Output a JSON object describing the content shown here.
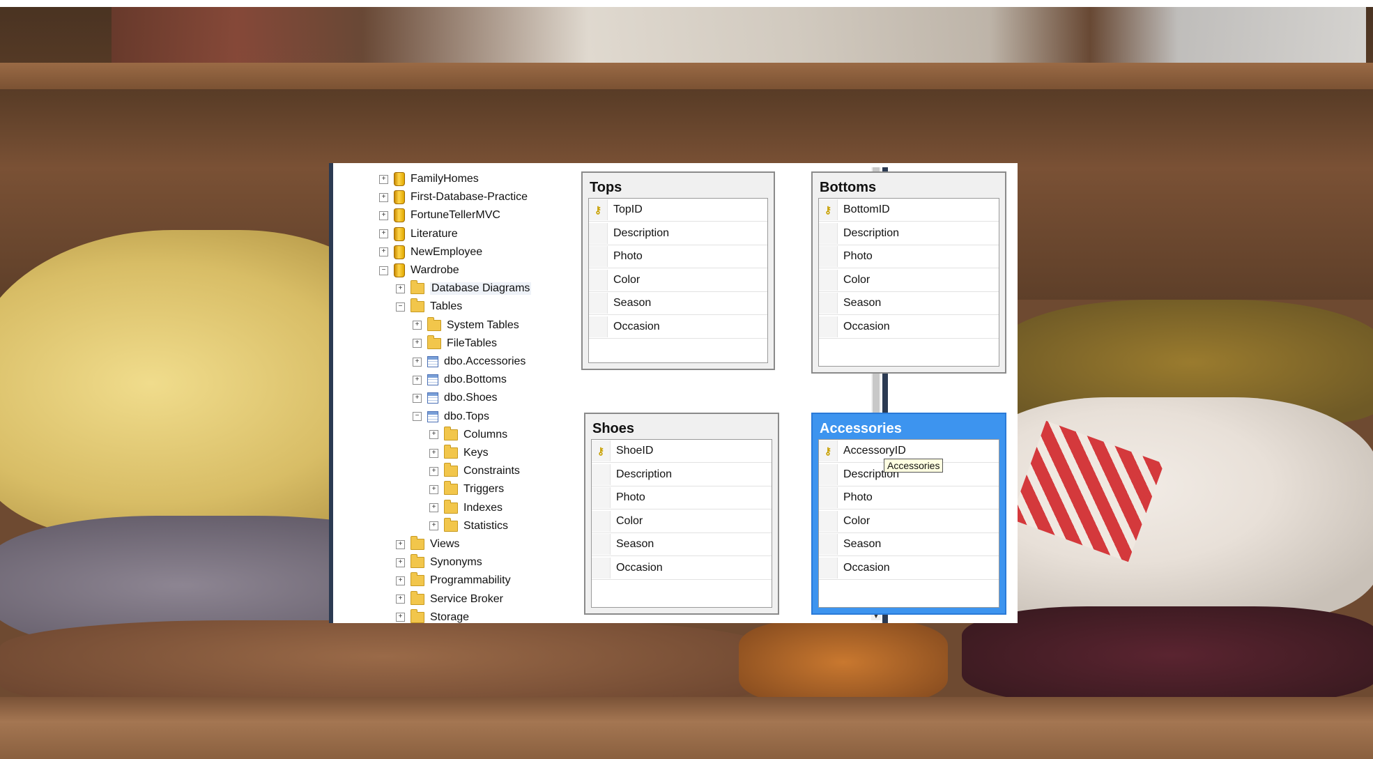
{
  "explorer": {
    "items": [
      {
        "label": "FamilyHomes",
        "icon": "database-icon",
        "expander": "+",
        "level": 0
      },
      {
        "label": "First-Database-Practice",
        "icon": "database-icon",
        "expander": "+",
        "level": 0
      },
      {
        "label": "FortuneTellerMVC",
        "icon": "database-icon",
        "expander": "+",
        "level": 0
      },
      {
        "label": "Literature",
        "icon": "database-icon",
        "expander": "+",
        "level": 0
      },
      {
        "label": "NewEmployee",
        "icon": "database-icon",
        "expander": "+",
        "level": 0
      },
      {
        "label": "Wardrobe",
        "icon": "database-icon",
        "expander": "−",
        "level": 0
      },
      {
        "label": "Database Diagrams",
        "icon": "folder-icon",
        "expander": "+",
        "level": 1
      },
      {
        "label": "Tables",
        "icon": "folder-icon",
        "expander": "−",
        "level": 1
      },
      {
        "label": "System Tables",
        "icon": "folder-icon",
        "expander": "+",
        "level": 2
      },
      {
        "label": "FileTables",
        "icon": "folder-icon",
        "expander": "+",
        "level": 2
      },
      {
        "label": "dbo.Accessories",
        "icon": "table-icon",
        "expander": "+",
        "level": 2
      },
      {
        "label": "dbo.Bottoms",
        "icon": "table-icon",
        "expander": "+",
        "level": 2
      },
      {
        "label": "dbo.Shoes",
        "icon": "table-icon",
        "expander": "+",
        "level": 2
      },
      {
        "label": "dbo.Tops",
        "icon": "table-icon",
        "expander": "−",
        "level": 2
      },
      {
        "label": "Columns",
        "icon": "folder-icon",
        "expander": "+",
        "level": 3
      },
      {
        "label": "Keys",
        "icon": "folder-icon",
        "expander": "+",
        "level": 3
      },
      {
        "label": "Constraints",
        "icon": "folder-icon",
        "expander": "+",
        "level": 3
      },
      {
        "label": "Triggers",
        "icon": "folder-icon",
        "expander": "+",
        "level": 3
      },
      {
        "label": "Indexes",
        "icon": "folder-icon",
        "expander": "+",
        "level": 3
      },
      {
        "label": "Statistics",
        "icon": "folder-icon",
        "expander": "+",
        "level": 3
      },
      {
        "label": "Views",
        "icon": "folder-icon",
        "expander": "+",
        "level": 1
      },
      {
        "label": "Synonyms",
        "icon": "folder-icon",
        "expander": "+",
        "level": 1
      },
      {
        "label": "Programmability",
        "icon": "folder-icon",
        "expander": "+",
        "level": 1
      },
      {
        "label": "Service Broker",
        "icon": "folder-icon",
        "expander": "+",
        "level": 1
      },
      {
        "label": "Storage",
        "icon": "folder-icon",
        "expander": "+",
        "level": 1
      }
    ],
    "selected": "Database Diagrams"
  },
  "diagram": {
    "tables": [
      {
        "id": "tops",
        "title": "Tops",
        "columns": [
          "TopID",
          "Description",
          "Photo",
          "Color",
          "Season",
          "Occasion"
        ],
        "active": false
      },
      {
        "id": "bottoms",
        "title": "Bottoms",
        "columns": [
          "BottomID",
          "Description",
          "Photo",
          "Color",
          "Season",
          "Occasion"
        ],
        "active": false
      },
      {
        "id": "shoes",
        "title": "Shoes",
        "columns": [
          "ShoeID",
          "Description",
          "Photo",
          "Color",
          "Season",
          "Occasion"
        ],
        "active": false
      },
      {
        "id": "accessories",
        "title": "Accessories",
        "columns": [
          "AccessoryID",
          "Description",
          "Photo",
          "Color",
          "Season",
          "Occasion"
        ],
        "active": true
      }
    ],
    "tooltip": "Accessories"
  },
  "colors": {
    "active_table": "#3d94ef",
    "window_border": "#2b3a52"
  }
}
